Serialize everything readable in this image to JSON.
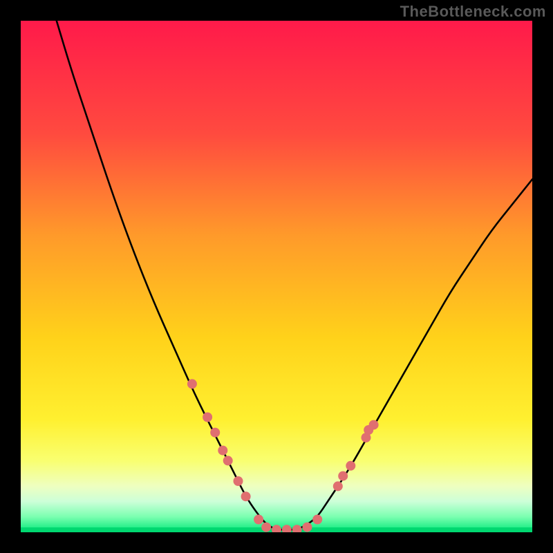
{
  "watermark": "TheBottleneck.com",
  "chart_data": {
    "type": "line",
    "title": "",
    "xlabel": "",
    "ylabel": "",
    "xlim": [
      0,
      100
    ],
    "ylim": [
      0,
      100
    ],
    "grid": false,
    "legend": false,
    "background_gradient": {
      "top": "#ff1a4a",
      "upper_mid": "#ff7a3a",
      "mid": "#ffd21a",
      "lower_mid": "#f9ff50",
      "band": "#e7ffb0",
      "bottom": "#00e878"
    },
    "series": [
      {
        "name": "bottleneck-curve",
        "color": "#000000",
        "x": [
          7,
          10,
          14,
          18,
          22,
          26,
          30,
          34,
          38,
          42,
          44,
          46,
          48,
          50,
          52,
          54,
          56,
          58,
          60,
          64,
          68,
          72,
          76,
          80,
          84,
          88,
          92,
          96,
          100
        ],
        "y": [
          100,
          90,
          78,
          66,
          55,
          45,
          36,
          27,
          19,
          11,
          7,
          4,
          1.5,
          0.5,
          0.5,
          0.5,
          1.5,
          3,
          6,
          12,
          19,
          26,
          33,
          40,
          47,
          53,
          59,
          64,
          69
        ]
      }
    ],
    "markers": [
      {
        "name": "reference-points",
        "color": "#e06f70",
        "points": [
          {
            "x": 33.5,
            "y": 29
          },
          {
            "x": 36.5,
            "y": 22.5
          },
          {
            "x": 38.0,
            "y": 19.5
          },
          {
            "x": 39.5,
            "y": 16
          },
          {
            "x": 40.5,
            "y": 14
          },
          {
            "x": 42.5,
            "y": 10
          },
          {
            "x": 44.0,
            "y": 7
          },
          {
            "x": 46.5,
            "y": 2.5
          },
          {
            "x": 48.0,
            "y": 1
          },
          {
            "x": 50.0,
            "y": 0.5
          },
          {
            "x": 52.0,
            "y": 0.5
          },
          {
            "x": 54.0,
            "y": 0.5
          },
          {
            "x": 56.0,
            "y": 1
          },
          {
            "x": 58.0,
            "y": 2.5
          },
          {
            "x": 62.0,
            "y": 9
          },
          {
            "x": 63.0,
            "y": 11
          },
          {
            "x": 64.5,
            "y": 13
          },
          {
            "x": 67.5,
            "y": 18.5
          },
          {
            "x": 68.0,
            "y": 20
          },
          {
            "x": 69.0,
            "y": 21
          }
        ]
      }
    ]
  }
}
